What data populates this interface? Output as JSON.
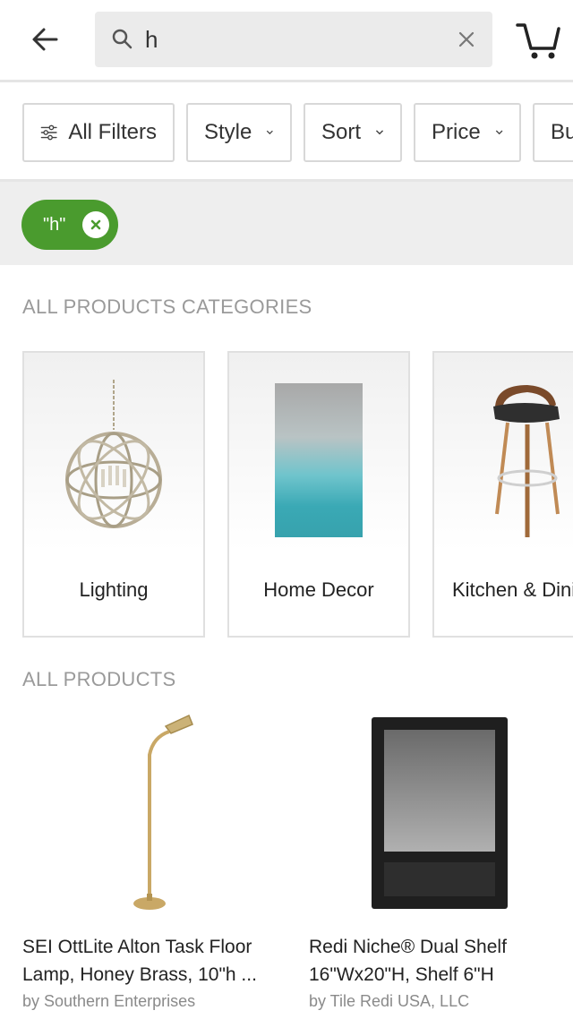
{
  "search": {
    "query": "h",
    "placeholder": ""
  },
  "filters": [
    {
      "label": "All Filters"
    },
    {
      "label": "Style"
    },
    {
      "label": "Sort"
    },
    {
      "label": "Price"
    },
    {
      "label": "Bu"
    }
  ],
  "active_chip": {
    "label": "\"h\""
  },
  "categories_section": {
    "title": "ALL PRODUCTS CATEGORIES",
    "items": [
      {
        "label": "Lighting"
      },
      {
        "label": "Home Decor"
      },
      {
        "label": "Kitchen & Dini"
      }
    ]
  },
  "products_section": {
    "title": "ALL PRODUCTS",
    "items": [
      {
        "name": "SEI OttLite Alton Task Floor Lamp, Honey Brass, 10\"h ...",
        "brand": "by Southern Enterprises"
      },
      {
        "name": "Redi Niche® Dual Shelf 16\"Wx20\"H, Shelf 6\"H",
        "brand": "by Tile Redi USA, LLC"
      }
    ]
  },
  "colors": {
    "accent_green": "#4a9b2e",
    "section_title_gray": "#9a9a9a",
    "chip_bar_bg": "#eeeeee"
  }
}
